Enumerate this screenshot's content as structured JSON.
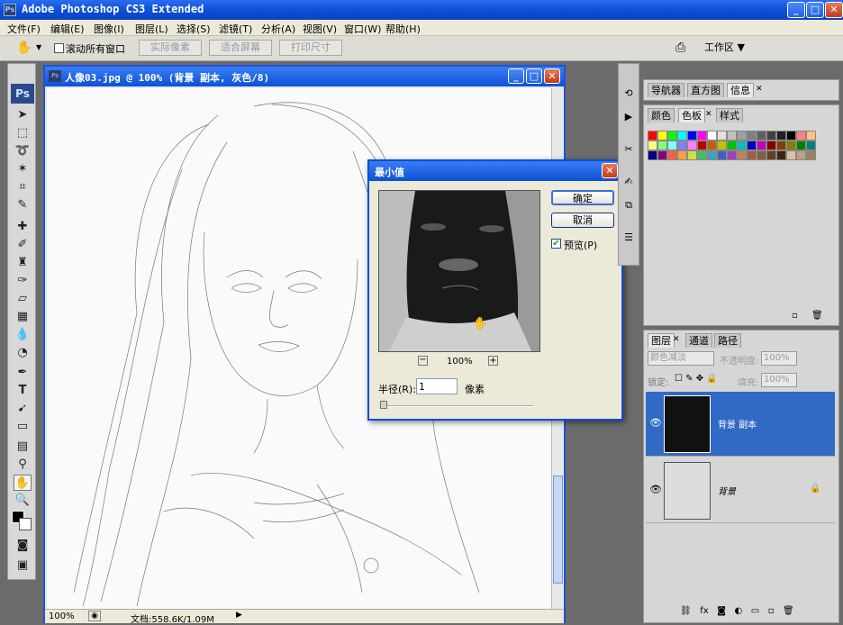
{
  "app": {
    "title": "Adobe Photoshop CS3 Extended",
    "logo": "Ps"
  },
  "menu": [
    "文件(F)",
    "编辑(E)",
    "图像(I)",
    "图层(L)",
    "选择(S)",
    "滤镜(T)",
    "分析(A)",
    "视图(V)",
    "窗口(W)",
    "帮助(H)"
  ],
  "options": {
    "scroll_all": "滚动所有窗口",
    "actual_pixels": "实际像素",
    "fit_screen": "适合屏幕",
    "print_size": "打印尺寸",
    "workspace": "工作区 ▼"
  },
  "document": {
    "title": "人像03.jpg @ 100% (背景 副本, 灰色/8)",
    "zoom": "100%",
    "doc_info": "文档:558.6K/1.09M"
  },
  "dialog": {
    "title": "最小值",
    "ok": "确定",
    "cancel": "取消",
    "preview_label": "预览(P)",
    "preview_checked": true,
    "zoom": "100%",
    "radius_label": "半径(R):",
    "radius_value": "1",
    "radius_unit": "像素"
  },
  "panels": {
    "nav_tabs": [
      "导航器",
      "直方图",
      "信息"
    ],
    "color_tabs": [
      "颜色",
      "色板",
      "样式"
    ],
    "layer_tabs": [
      "图层",
      "通道",
      "路径"
    ],
    "blend_mode": "颜色减淡",
    "opacity_label": "不透明度:",
    "opacity_value": "100%",
    "lock_label": "锁定:",
    "fill_label": "填充:",
    "fill_value": "100%",
    "layers": [
      {
        "name": "背景 副本",
        "selected": true
      },
      {
        "name": "背景",
        "selected": false
      }
    ]
  },
  "colors": {
    "titlebar": "#0a4ed6",
    "selected_layer": "#316ac5",
    "swatches": [
      "#ff0000",
      "#ffff00",
      "#00ff00",
      "#00ffff",
      "#0000ff",
      "#ff00ff",
      "#ffffff",
      "#e0e0e0",
      "#c0c0c0",
      "#a0a0a0",
      "#808080",
      "#606060",
      "#404040",
      "#202020",
      "#000000",
      "#ff8080",
      "#ffc080",
      "#ffff80",
      "#80ff80",
      "#80ffff",
      "#8080ff",
      "#ff80ff",
      "#c00000",
      "#c06000",
      "#c0c000",
      "#00c000",
      "#00c0c0",
      "#0000c0",
      "#c000c0",
      "#800000",
      "#804000",
      "#808000",
      "#008000",
      "#008080",
      "#000080",
      "#800080",
      "#ff6040",
      "#ffa040",
      "#d0e040",
      "#40c060",
      "#40a0c0",
      "#4060c0",
      "#a040c0",
      "#c08060",
      "#a06040",
      "#806040",
      "#604020",
      "#402010",
      "#e0c0a0",
      "#c0a080",
      "#a08060"
    ]
  }
}
